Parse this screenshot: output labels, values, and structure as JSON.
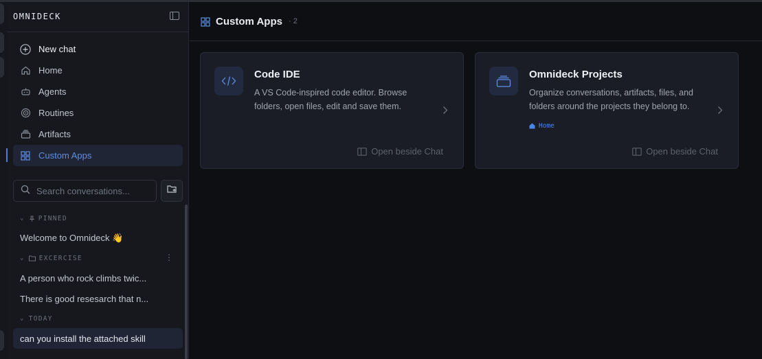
{
  "app": {
    "brand": "OMNIDECK"
  },
  "colors": {
    "accent": "#4a86e8",
    "active_bg": "#1f2535",
    "sidebar_bg": "#16181d",
    "card_bg": "#1a1d26"
  },
  "sidebar": {
    "nav": [
      {
        "label": "New chat",
        "icon": "plus-circle-icon"
      },
      {
        "label": "Home",
        "icon": "home-icon"
      },
      {
        "label": "Agents",
        "icon": "robot-icon"
      },
      {
        "label": "Routines",
        "icon": "target-icon"
      },
      {
        "label": "Artifacts",
        "icon": "stack-icon"
      },
      {
        "label": "Custom Apps",
        "icon": "grid-icon",
        "active": true
      }
    ],
    "search": {
      "placeholder": "Search conversations..."
    },
    "sections": [
      {
        "label": "PINNED",
        "items": [
          "Welcome to Omnideck 👋"
        ]
      },
      {
        "label": "EXCERCISE",
        "items": [
          "A person who rock climbs twic...",
          "There is good resesarch that n..."
        ]
      },
      {
        "label": "TODAY",
        "items": [
          "can you install the attached skill"
        ]
      }
    ]
  },
  "main": {
    "title": "Custom Apps",
    "count": "· 2",
    "cards": [
      {
        "title": "Code IDE",
        "icon": "code-icon",
        "description": "A VS Code-inspired code editor. Browse folders, open files, edit and save them.",
        "action": "Open beside Chat"
      },
      {
        "title": "Omnideck Projects",
        "icon": "projects-icon",
        "description": "Organize conversations, artifacts, files, and folders around the projects they belong to.",
        "tag": "Home",
        "action": "Open beside Chat"
      }
    ]
  }
}
